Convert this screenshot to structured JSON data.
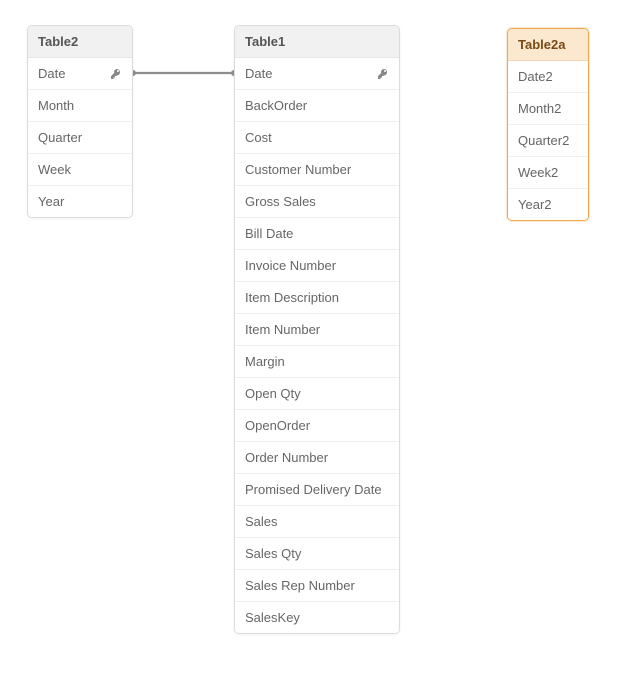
{
  "connector": {
    "from": "table2.date",
    "to": "table1.date",
    "color": "#8d8d8d"
  },
  "tables": {
    "table2": {
      "title": "Table2",
      "highlight": false,
      "fields": [
        {
          "label": "Date",
          "key": true
        },
        {
          "label": "Month",
          "key": false
        },
        {
          "label": "Quarter",
          "key": false
        },
        {
          "label": "Week",
          "key": false
        },
        {
          "label": "Year",
          "key": false
        }
      ]
    },
    "table1": {
      "title": "Table1",
      "highlight": false,
      "fields": [
        {
          "label": "Date",
          "key": true
        },
        {
          "label": "BackOrder",
          "key": false
        },
        {
          "label": "Cost",
          "key": false
        },
        {
          "label": "Customer Number",
          "key": false
        },
        {
          "label": "Gross Sales",
          "key": false
        },
        {
          "label": "Bill Date",
          "key": false
        },
        {
          "label": "Invoice Number",
          "key": false
        },
        {
          "label": "Item Description",
          "key": false
        },
        {
          "label": "Item Number",
          "key": false
        },
        {
          "label": "Margin",
          "key": false
        },
        {
          "label": "Open Qty",
          "key": false
        },
        {
          "label": "OpenOrder",
          "key": false
        },
        {
          "label": "Order Number",
          "key": false
        },
        {
          "label": "Promised Delivery Date",
          "key": false
        },
        {
          "label": "Sales",
          "key": false
        },
        {
          "label": "Sales Qty",
          "key": false
        },
        {
          "label": "Sales Rep Number",
          "key": false
        },
        {
          "label": "SalesKey",
          "key": false
        }
      ]
    },
    "table2a": {
      "title": "Table2a",
      "highlight": true,
      "fields": [
        {
          "label": "Date2",
          "key": false
        },
        {
          "label": "Month2",
          "key": false
        },
        {
          "label": "Quarter2",
          "key": false
        },
        {
          "label": "Week2",
          "key": false
        },
        {
          "label": "Year2",
          "key": false
        }
      ]
    }
  }
}
